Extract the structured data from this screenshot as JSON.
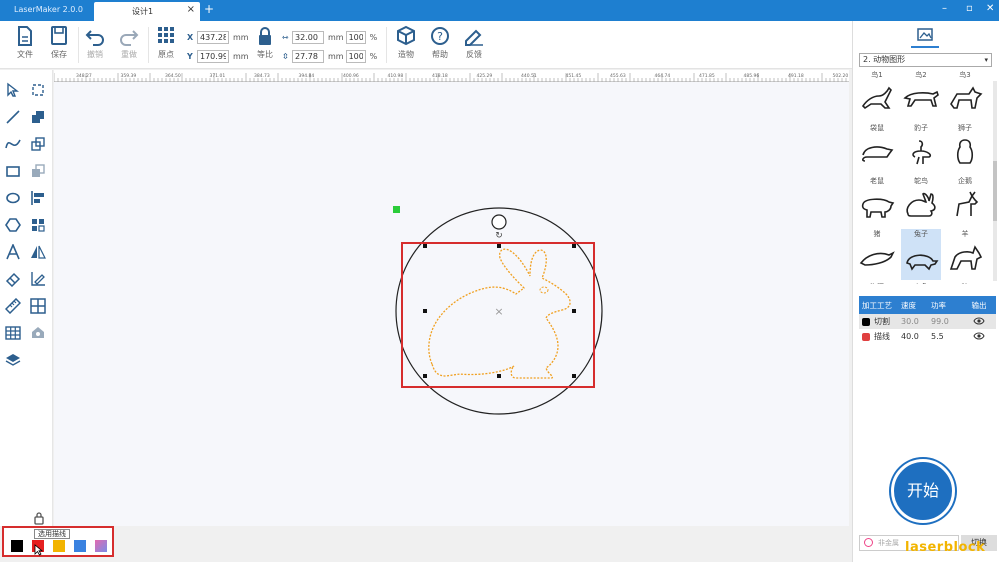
{
  "window": {
    "app_title": "LaserMaker 2.0.0",
    "doc_tab": "设计1",
    "new_tab": "+",
    "close_tab": "×",
    "controls": [
      "–",
      "▫",
      "✕"
    ]
  },
  "toolbar": {
    "file": "文件",
    "save": "保存",
    "undo": "撤销",
    "redo": "重做",
    "origin": "原点",
    "x_label": "X",
    "y_label": "Y",
    "x_value": "437.28",
    "y_value": "170.99",
    "unit": "mm",
    "width_value": "32.00",
    "height_value": "27.78",
    "scale_w": "100",
    "scale_h": "100",
    "pct": "%",
    "ratio": "等比",
    "build": "造物",
    "help": "帮助",
    "feedback": "反馈"
  },
  "ruler": {
    "labels": [
      "348.27",
      "359.39",
      "364.50",
      "371.01",
      "384.73",
      "394.84",
      "400.96",
      "410.98",
      "418.18",
      "425.29",
      "440.51",
      "451.45",
      "455.63",
      "464.74",
      "471.85",
      "485.96",
      "491.18",
      "502.20"
    ]
  },
  "canvas": {
    "rotate_glyph": "↻",
    "center_glyph": "×"
  },
  "color_bar": {
    "tooltip": "选用描线",
    "swatches": [
      "#000000",
      "#e52020",
      "#f2b400",
      "#3a82e0",
      "#e36ab0"
    ]
  },
  "right_panel": {
    "category": "2. 动物图形",
    "dropdown_arrow": "▾",
    "shapes": [
      {
        "label": "鸟1",
        "icon": "kangaroo-icon"
      },
      {
        "label": "鸟2",
        "icon": "cheetah-icon"
      },
      {
        "label": "鸟3",
        "icon": "fox-icon"
      },
      {
        "label": "袋鼠",
        "icon": "mouse-icon"
      },
      {
        "label": "豹子",
        "icon": "ostrich-icon"
      },
      {
        "label": "狮子",
        "icon": "penguin-icon"
      },
      {
        "label": "老鼠",
        "icon": "pig-icon"
      },
      {
        "label": "鸵鸟",
        "icon": "rabbit-icon"
      },
      {
        "label": "企鹅",
        "icon": "deer-icon"
      },
      {
        "label": "猪",
        "icon": "dolphin-icon"
      },
      {
        "label": "兔子",
        "icon": "turtle-icon"
      },
      {
        "label": "羊",
        "icon": "wolf-icon"
      },
      {
        "label": "海豚",
        "icon": ""
      },
      {
        "label": "乌龟",
        "icon": ""
      },
      {
        "label": "狼",
        "icon": ""
      }
    ],
    "layer_table": {
      "headers": [
        "加工工艺",
        "速度",
        "功率",
        "输出"
      ],
      "rows": [
        {
          "color": "#000000",
          "mode": "切割",
          "speed": "30.0",
          "power": "99.0"
        },
        {
          "color": "#e04040",
          "mode": "描线",
          "speed": "40.0",
          "power": "5.5"
        }
      ]
    },
    "start": "开始",
    "footer_placeholder": "非金属",
    "switch": "切换"
  },
  "watermark": "laserblock",
  "accent": "#1e7fd0"
}
